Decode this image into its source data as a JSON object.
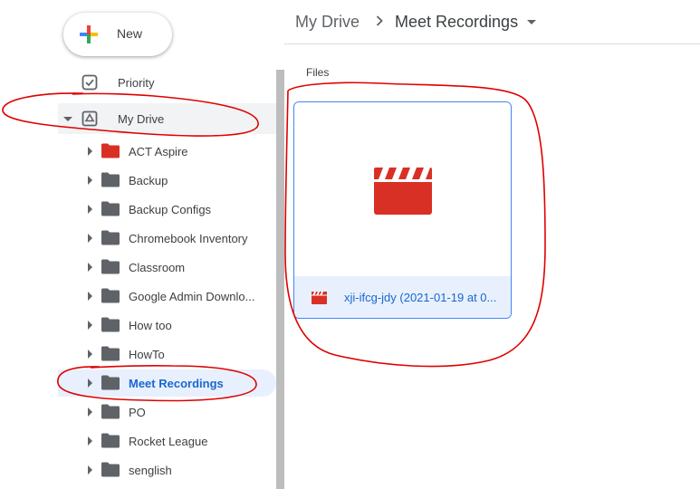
{
  "new_button": {
    "label": "New"
  },
  "sidebar": {
    "priority_label": "Priority",
    "mydrive_label": "My Drive",
    "folders": [
      {
        "label": "ACT Aspire",
        "color": "#d93025",
        "selected": false
      },
      {
        "label": "Backup",
        "color": "#5f6368",
        "selected": false
      },
      {
        "label": "Backup Configs",
        "color": "#5f6368",
        "selected": false
      },
      {
        "label": "Chromebook Inventory",
        "color": "#5f6368",
        "selected": false
      },
      {
        "label": "Classroom",
        "color": "#5f6368",
        "selected": false
      },
      {
        "label": "Google Admin Downlo...",
        "color": "#5f6368",
        "selected": false
      },
      {
        "label": "How too",
        "color": "#5f6368",
        "selected": false
      },
      {
        "label": "HowTo",
        "color": "#5f6368",
        "selected": false
      },
      {
        "label": "Meet Recordings",
        "color": "#5f6368",
        "selected": true
      },
      {
        "label": "PO",
        "color": "#5f6368",
        "selected": false
      },
      {
        "label": "Rocket League",
        "color": "#5f6368",
        "selected": false
      },
      {
        "label": "senglish",
        "color": "#5f6368",
        "selected": false
      }
    ]
  },
  "breadcrumb": {
    "root": "My Drive",
    "current": "Meet Recordings"
  },
  "content": {
    "section_label": "Files",
    "file": {
      "name": "xji-ifcg-jdy (2021-01-19 at 0...",
      "icon": "video-clapperboard-icon"
    }
  },
  "colors": {
    "accent": "#1967d2",
    "selection_bg": "#e8f0fe",
    "video_red": "#d93025",
    "annotation_red": "#e00000"
  }
}
